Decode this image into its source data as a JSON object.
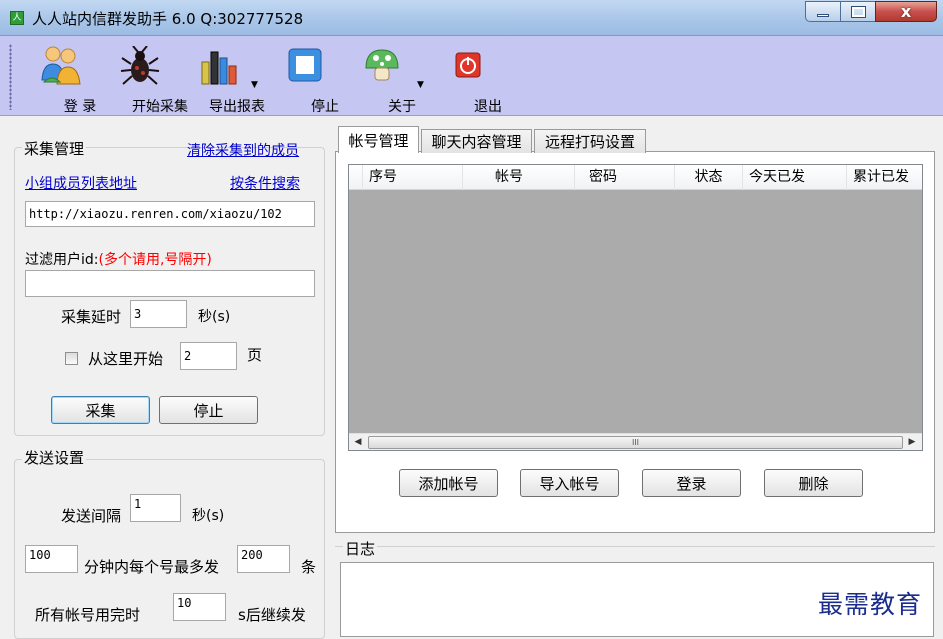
{
  "window": {
    "title": "人人站内信群发助手 6.0 Q:302777528",
    "close_glyph": "x"
  },
  "toolbar": {
    "login": "登 录",
    "start_collect": "开始采集",
    "export_report": "导出报表",
    "stop": "停止",
    "about": "关于",
    "exit": "退出"
  },
  "collect": {
    "group_title": "采集管理",
    "clear_link": "清除采集到的成员",
    "group_url_link": "小组成员列表地址",
    "search_link": "按条件搜索",
    "url_value": "http://xiaozu.renren.com/xiaozu/102",
    "filter_label": "过滤用户id:",
    "filter_hint": "(多个请用,号隔开)",
    "filter_value": "",
    "delay_label": "采集延时",
    "delay_value": "3",
    "delay_unit": "秒(s)",
    "start_here_label": "从这里开始",
    "start_here_checked": false,
    "start_page_value": "2",
    "page_unit": "页",
    "collect_button": "采集",
    "stop_button": "停止"
  },
  "send": {
    "group_title": "发送设置",
    "interval_label": "发送间隔",
    "interval_value": "1",
    "interval_unit": "秒(s)",
    "minutes_value": "100",
    "per_account_label": "分钟内每个号最多发",
    "max_value": "200",
    "max_unit": "条",
    "all_used_label": "所有帐号用完时",
    "resume_value": "10",
    "resume_label": "s后继续发"
  },
  "tabs": [
    "帐号管理",
    "聊天内容管理",
    "远程打码设置"
  ],
  "accounts": {
    "columns": [
      "序号",
      "帐号",
      "密码",
      "状态",
      "今天已发",
      "累计已发"
    ],
    "rows": [],
    "scroll_thumb_glyph": "III",
    "add_button": "添加帐号",
    "import_button": "导入帐号",
    "login_button": "登录",
    "delete_button": "删除"
  },
  "log": {
    "title": "日志",
    "content": ""
  },
  "watermark": "最需教育",
  "colors": {
    "toolbar_bg": "#c6c6f2",
    "link": "#0000cc",
    "hint_red": "#ff0000",
    "grid_bg": "#ababab"
  }
}
